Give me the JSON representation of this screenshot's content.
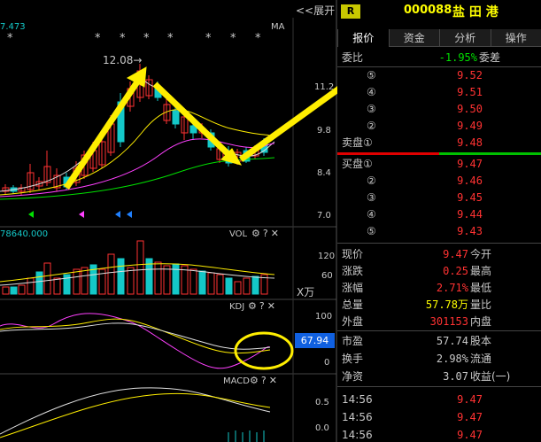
{
  "header": {
    "expand_label": "<<展开",
    "r_badge": "R",
    "stock_code": "000088",
    "stock_name": "盐 田 港",
    "ma_readout": "7.473",
    "ma_label": "MA"
  },
  "tabs": [
    {
      "label": "报价",
      "active": true
    },
    {
      "label": "资金",
      "active": false
    },
    {
      "label": "分析",
      "active": false
    },
    {
      "label": "操作",
      "active": false
    }
  ],
  "price_chart": {
    "high_marker": "12.08→",
    "y_ticks": [
      "11.2",
      "9.8",
      "8.4",
      "7.0"
    ],
    "stars": [
      "*",
      "*",
      "*",
      "*",
      "*",
      "*",
      "*"
    ]
  },
  "vol_panel": {
    "readout": "78640.000",
    "title": "VOL",
    "y_ticks": [
      "120",
      "60",
      "X万"
    ]
  },
  "kdj_panel": {
    "title": "KDJ",
    "y_ticks": [
      "100",
      "0"
    ],
    "current_value": "67.94"
  },
  "macd_panel": {
    "title": "MACD",
    "y_ticks": [
      "0.5",
      "0.0"
    ]
  },
  "panel_icons": {
    "gear": "⚙",
    "help": "?",
    "close": "✕"
  },
  "weibi": {
    "label": "委比",
    "value": "-1.95%",
    "label2": "委差"
  },
  "asks": [
    {
      "level": "⑤",
      "price": "9.52"
    },
    {
      "level": "④",
      "price": "9.51"
    },
    {
      "level": "③",
      "price": "9.50"
    },
    {
      "level": "②",
      "price": "9.49"
    },
    {
      "level": "卖盘①",
      "price": "9.48"
    }
  ],
  "bids": [
    {
      "level": "买盘①",
      "price": "9.47"
    },
    {
      "level": "②",
      "price": "9.46"
    },
    {
      "level": "③",
      "price": "9.45"
    },
    {
      "level": "④",
      "price": "9.44"
    },
    {
      "level": "⑤",
      "price": "9.43"
    }
  ],
  "quote": [
    {
      "label": "现价",
      "value": "9.47",
      "label2": "今开",
      "color": "#ff3232"
    },
    {
      "label": "涨跌",
      "value": "0.25",
      "label2": "最高",
      "color": "#ff3232"
    },
    {
      "label": "涨幅",
      "value": "2.71%",
      "label2": "最低",
      "color": "#ff3232"
    },
    {
      "label": "总量",
      "value": "57.78万",
      "label2": "量比",
      "color": "#ffff00"
    },
    {
      "label": "外盘",
      "value": "301153",
      "label2": "内盘",
      "color": "#ff3232"
    }
  ],
  "fundamentals": [
    {
      "label": "市盈",
      "value": "57.74",
      "label2": "股本"
    },
    {
      "label": "换手",
      "value": "2.98%",
      "label2": "流通"
    },
    {
      "label": "净资",
      "value": "3.07",
      "label2": "收益(一)"
    }
  ],
  "ticks": [
    {
      "time": "14:56",
      "price": "9.47"
    },
    {
      "time": "14:56",
      "price": "9.47"
    },
    {
      "time": "14:56",
      "price": "9.47"
    }
  ]
}
